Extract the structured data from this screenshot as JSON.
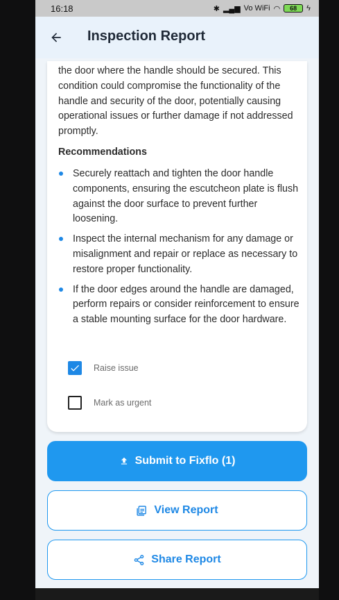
{
  "status_bar": {
    "time": "16:18",
    "network": "Vo WiFi",
    "battery": "68"
  },
  "app_bar": {
    "title": "Inspection Report",
    "back_icon": "arrow-left-icon"
  },
  "report": {
    "paragraph": "the door where the handle should be secured. This condition could compromise the functionality of the handle and security of the door, potentially causing operational issues or further damage if not addressed promptly.",
    "recommendations_title": "Recommendations",
    "recommendations": [
      "Securely reattach and tighten the door handle components, ensuring the escutcheon plate is flush against the door surface to prevent further loosening.",
      "Inspect the internal mechanism for any damage or misalignment and repair or replace as necessary to restore proper functionality.",
      "If the door edges around the handle are damaged, perform repairs or consider reinforcement to ensure a stable mounting surface for the door hardware."
    ]
  },
  "options": {
    "raise_issue": {
      "label": "Raise issue",
      "checked": true
    },
    "mark_urgent": {
      "label": "Mark as urgent",
      "checked": false
    }
  },
  "actions": {
    "submit_label": "Submit to Fixflo (1)",
    "view_label": "View Report",
    "share_label": "Share Report"
  },
  "colors": {
    "accent": "#1f98ef",
    "app_bar_bg": "#e9f2fb",
    "page_bg": "#eff4f9"
  }
}
